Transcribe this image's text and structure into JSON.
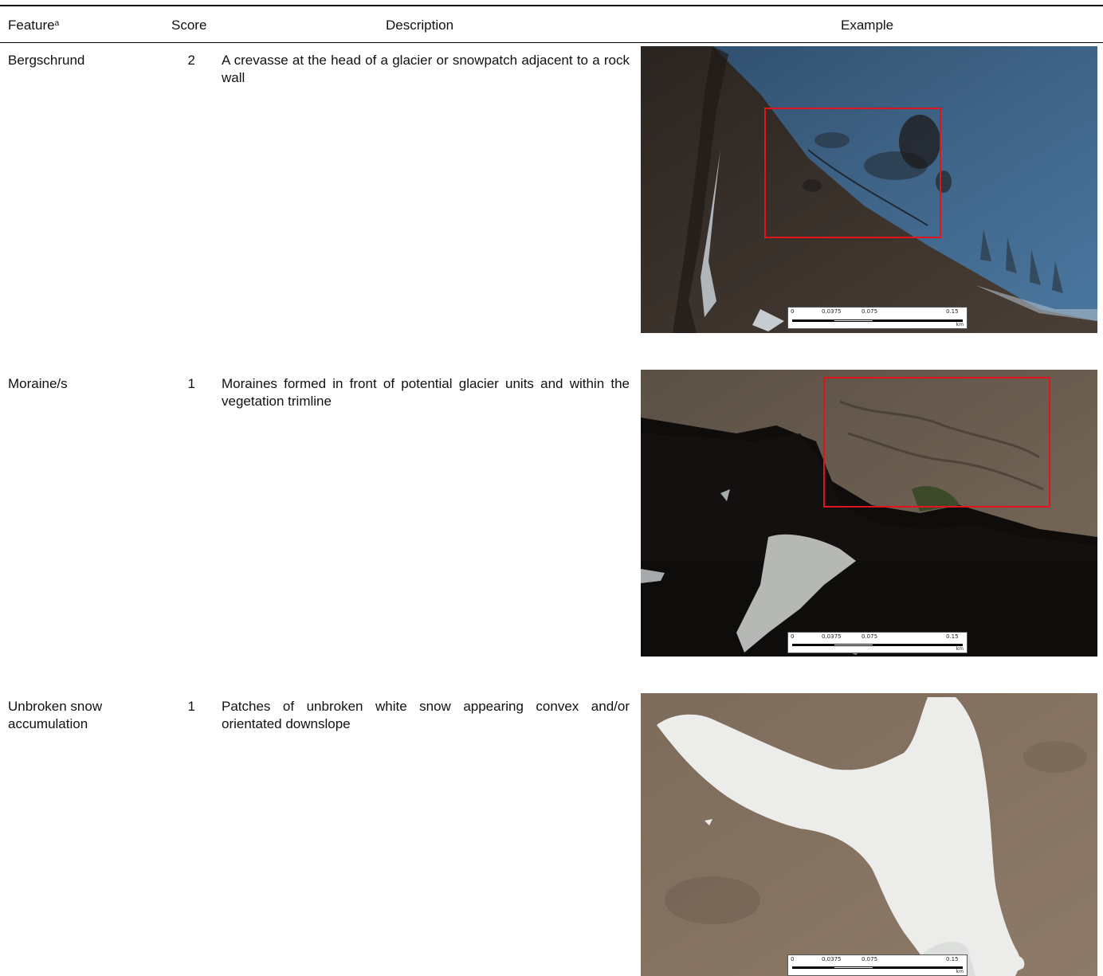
{
  "header": {
    "feature": "Feature",
    "feature_sup": "a",
    "score": "Score",
    "description": "Description",
    "example": "Example"
  },
  "rows": [
    {
      "feature": "Bergschrund",
      "score": "2",
      "description": "A crevasse at the head of a glacier or snowpatch adjacent to a rock wall",
      "scale_labels": [
        "0",
        "0.0375",
        "0.075",
        "0.15"
      ],
      "scale_unit": "km"
    },
    {
      "feature": "Moraine/s",
      "score": "1",
      "description": "Moraines formed in front of potential glacier units and within the vegetation trimline",
      "scale_labels": [
        "0",
        "0.0375",
        "0.075",
        "0.15"
      ],
      "scale_unit": "km"
    },
    {
      "feature": "Unbroken snow accumulation",
      "score": "1",
      "description": "Patches of unbroken white snow appearing convex and/or orientated downslope",
      "scale_labels": [
        "0",
        "0.0375",
        "0.075",
        "0.15"
      ],
      "scale_unit": "km"
    }
  ],
  "colors": {
    "highlight_box": "#e0141a",
    "rule": "#000000"
  }
}
